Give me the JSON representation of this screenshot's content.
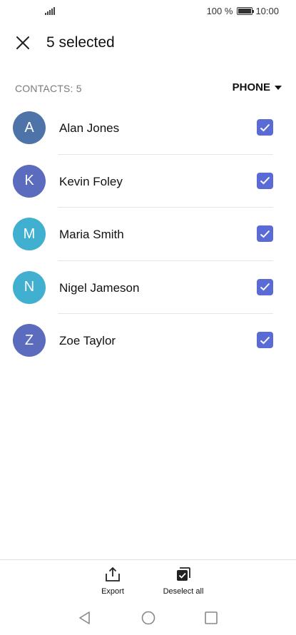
{
  "status_bar": {
    "battery_percent": "100 %",
    "time": "10:00"
  },
  "app_bar": {
    "title": "5 selected",
    "close_icon": "close-icon"
  },
  "list_header": {
    "count_label": "CONTACTS: 5",
    "account_filter": "PHONE"
  },
  "colors": {
    "accent": "#5b6bd6",
    "avatar_steel_blue": "#4e73a8",
    "avatar_indigo": "#5b6bbd",
    "avatar_cyan": "#41b0d0"
  },
  "contacts": [
    {
      "initial": "A",
      "name": "Alan Jones",
      "avatar_color": "#4e73a8",
      "checked": true
    },
    {
      "initial": "K",
      "name": "Kevin Foley",
      "avatar_color": "#5b6bbd",
      "checked": true
    },
    {
      "initial": "M",
      "name": "Maria Smith",
      "avatar_color": "#41b0d0",
      "checked": true
    },
    {
      "initial": "N",
      "name": "Nigel Jameson",
      "avatar_color": "#41b0d0",
      "checked": true
    },
    {
      "initial": "Z",
      "name": "Zoe Taylor",
      "avatar_color": "#5b6bbd",
      "checked": true
    }
  ],
  "bottom_actions": {
    "export_label": "Export",
    "export_icon": "share-export-icon",
    "deselect_label": "Deselect all",
    "deselect_icon": "deselect-all-icon"
  },
  "nav_bar": {
    "back_icon": "triangle-back-icon",
    "home_icon": "circle-home-icon",
    "recents_icon": "square-recents-icon"
  }
}
